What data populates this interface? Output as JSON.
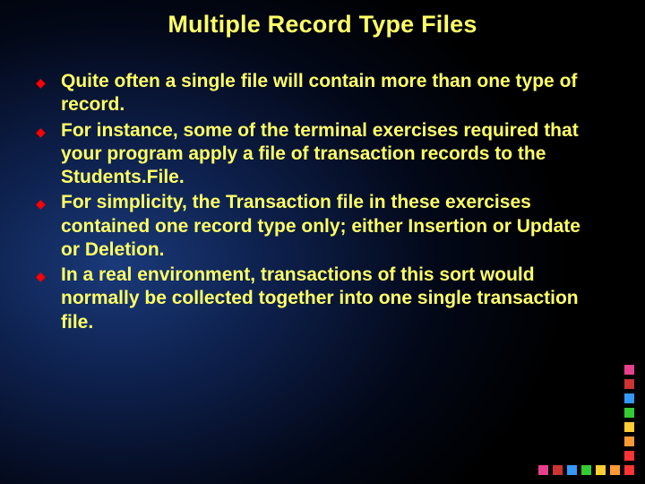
{
  "title": "Multiple Record Type Files",
  "bullets": [
    "Quite often a single file will contain more than one type of record.",
    "For instance, some of the terminal exercises required that your program apply a file of transaction records to the Students.File.",
    "For simplicity, the Transaction file in these exercises contained one record type only; either Insertion or Update or Deletion.",
    "In a real environment, transactions of this sort would normally be collected together into one single transaction file."
  ],
  "deco": {
    "vertical": [
      "#e83f8c",
      "#cc3333",
      "#3399ff",
      "#33cc33",
      "#ffcc33",
      "#ff9933",
      "#ff3333"
    ],
    "horizontal": [
      "#e83f8c",
      "#cc3333",
      "#3399ff",
      "#33cc33",
      "#ffcc33",
      "#ff9933",
      "#ff3333"
    ]
  }
}
